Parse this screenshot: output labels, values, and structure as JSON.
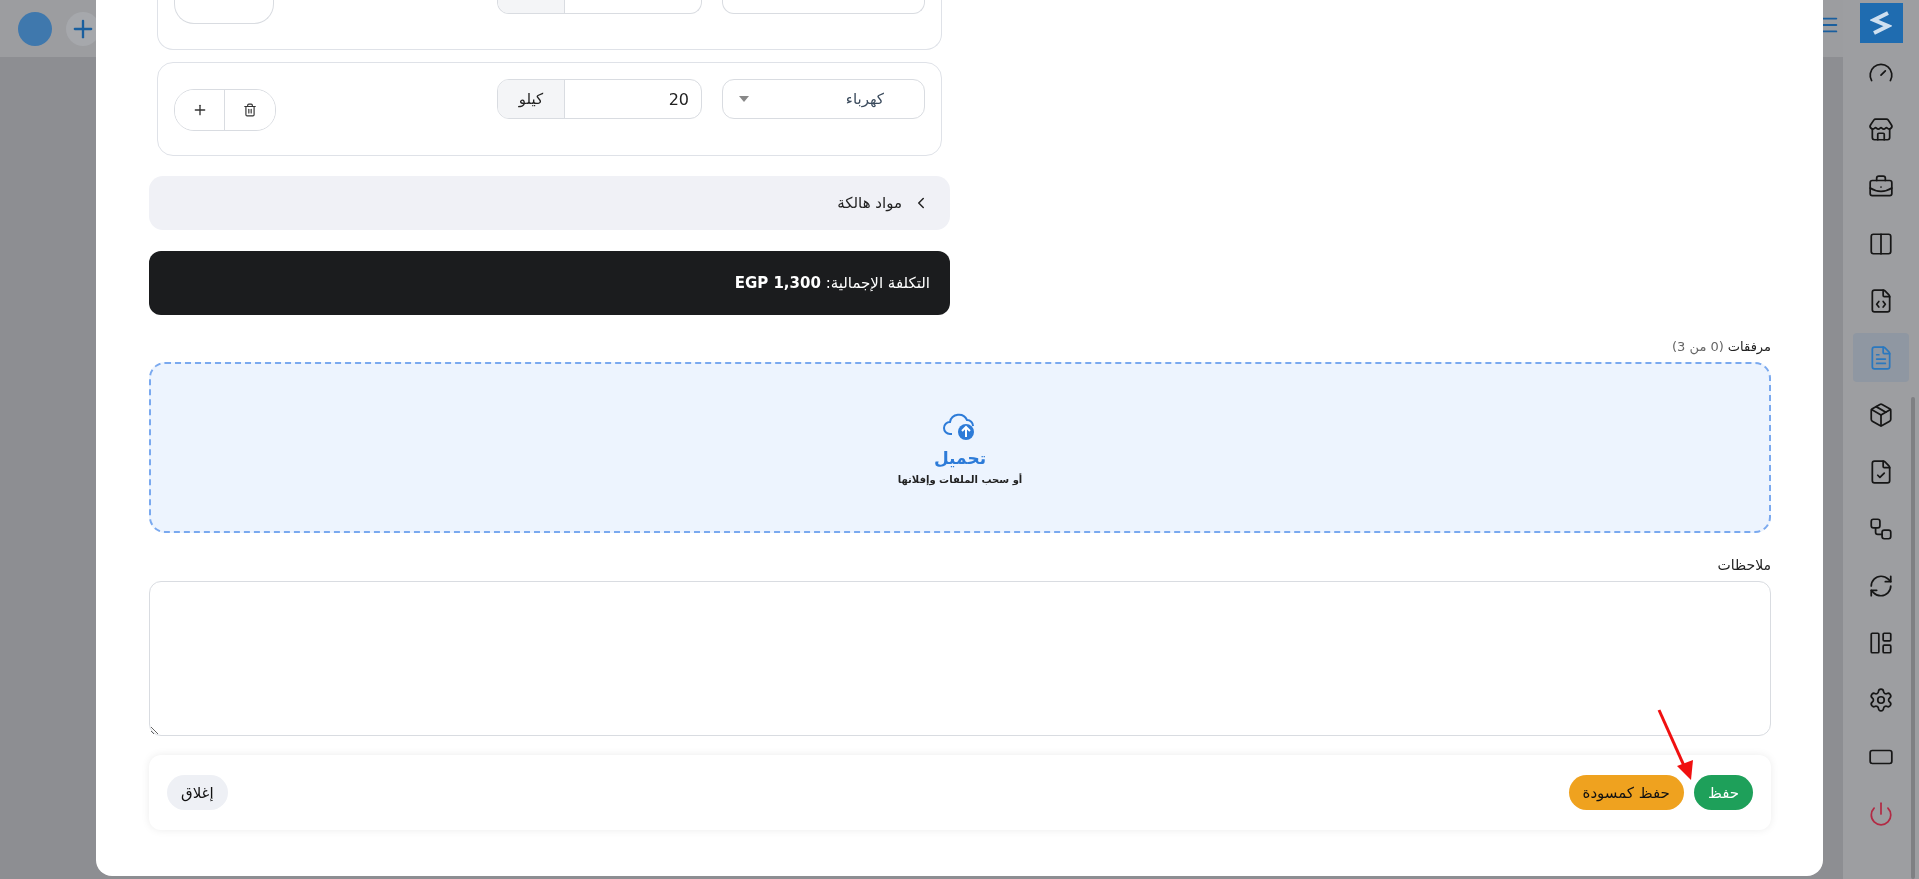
{
  "sidebar": {
    "items": [
      {
        "selected": false
      },
      {
        "selected": false
      },
      {
        "selected": false
      },
      {
        "selected": false
      },
      {
        "selected": false
      },
      {
        "selected": true
      },
      {
        "selected": false
      },
      {
        "selected": false
      },
      {
        "selected": false
      },
      {
        "selected": false
      },
      {
        "selected": false
      },
      {
        "selected": false
      },
      {
        "selected": false
      },
      {
        "selected": false
      }
    ]
  },
  "materials": {
    "rows": [
      {
        "kind": "cut_off"
      },
      {
        "kind": "full",
        "material": "كهرباء",
        "quantity": "20",
        "unit": "كيلو"
      }
    ]
  },
  "hazardous_section": {
    "label": "مواد هالكة",
    "expanded": false
  },
  "total": "التكلفة الإجمالية: **EGP 1,300**",
  "attachments": {
    "label": "مرفقات",
    "count": "(0 من 3)",
    "upload_title": "تحميل",
    "upload_hint": "أو سحب الملفات وإفلاتها"
  },
  "notes": {
    "label": "ملاحظات"
  },
  "footer_buttons": [
    {
      "kind": "primary",
      "label": "حفظ"
    },
    {
      "kind": "warning",
      "label": "حفظ كمسودة"
    },
    {
      "kind": "secondary",
      "label": "إغلاق"
    }
  ]
}
